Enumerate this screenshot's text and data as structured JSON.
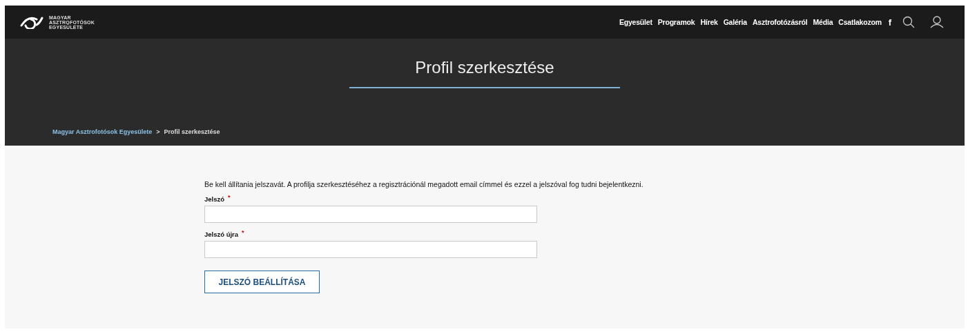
{
  "header": {
    "logo_lines": [
      "MAGYAR",
      "ASZTROFOTÓSOK",
      "EGYESÜLETE"
    ],
    "nav": [
      "Egyesület",
      "Programok",
      "Hírek",
      "Galéria",
      "Asztrofotózásról",
      "Média",
      "Csatlakozom"
    ],
    "social": "f"
  },
  "hero": {
    "title": "Profil szerkesztése",
    "breadcrumb": [
      {
        "label": "Magyar Asztrofotósok Egyesülete",
        "link": true
      },
      {
        "label": ">",
        "link": false
      },
      {
        "label": "Profil szerkesztése",
        "link": false
      }
    ]
  },
  "form": {
    "intro": "Be kell állítania jelszavát. A profilja szerkesztéséhez a regisztrációnál megadott email címmel és ezzel a jelszóval fog tudni bejelentkezni.",
    "fields": [
      {
        "label": "Jelszó",
        "required": true
      },
      {
        "label": "Jelszó újra",
        "required": true
      }
    ],
    "required_mark": "*",
    "submit": "JELSZÓ BEÁLLÍTÁSA"
  }
}
